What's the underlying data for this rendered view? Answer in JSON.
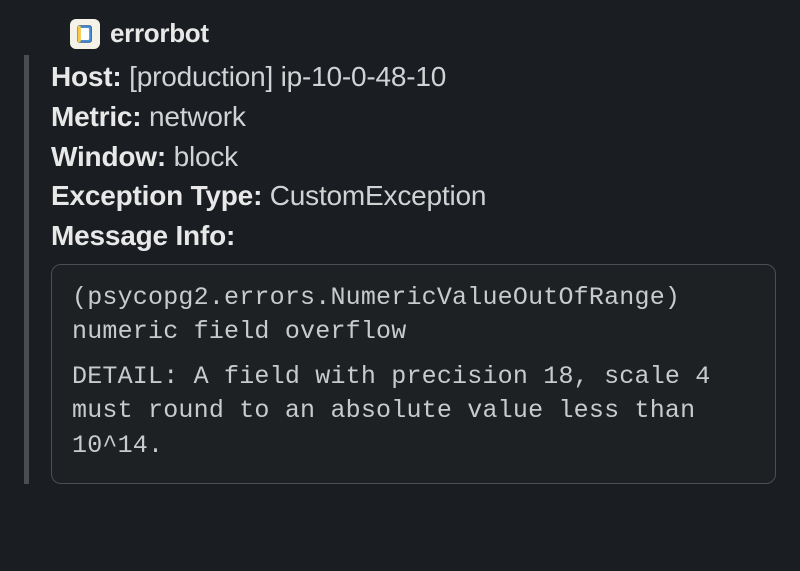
{
  "bot": {
    "name": "errorbot"
  },
  "fields": {
    "host_label": "Host",
    "host_value": "[production] ip-10-0-48-10",
    "metric_label": "Metric",
    "metric_value": "network",
    "window_label": "Window",
    "window_value": "block",
    "exception_label": "Exception Type",
    "exception_value": "CustomException",
    "message_label": "Message Info"
  },
  "code": {
    "line1": "(psycopg2.errors.NumericValueOutOfRange) numeric field overflow",
    "line2": "DETAIL:  A field with precision 18, scale 4 must round to an absolute value less than 10^14."
  }
}
